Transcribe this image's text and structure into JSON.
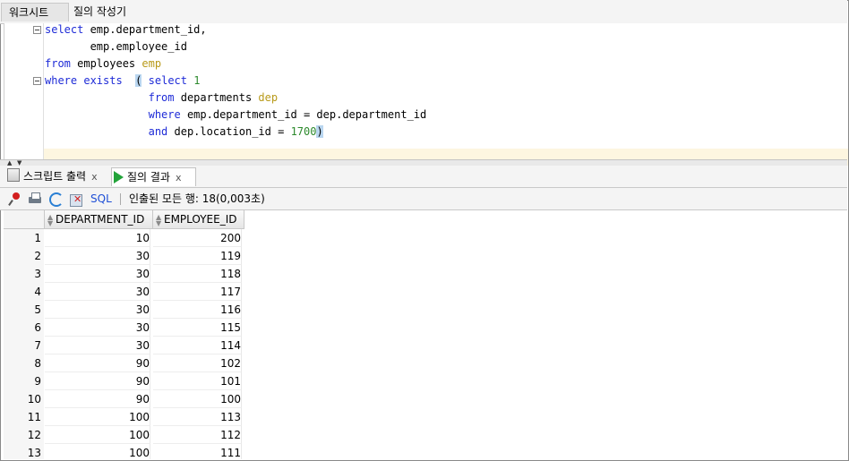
{
  "top_tabs": {
    "worksheet": "워크시트",
    "query_builder": "질의 작성기"
  },
  "editor": {
    "lines": [
      [
        {
          "t": "select",
          "c": "kw"
        },
        {
          "t": " emp.department_id,",
          "c": ""
        }
      ],
      [
        {
          "t": "       emp.employee_id",
          "c": ""
        }
      ],
      [
        {
          "t": "from",
          "c": "kw"
        },
        {
          "t": " employees ",
          "c": ""
        },
        {
          "t": "emp",
          "c": "alias"
        }
      ],
      [
        {
          "t": "where",
          "c": "kw"
        },
        {
          "t": " ",
          "c": ""
        },
        {
          "t": "exists",
          "c": "kw"
        },
        {
          "t": "  ",
          "c": ""
        },
        {
          "t": "(",
          "c": "lpar"
        },
        {
          "t": " ",
          "c": ""
        },
        {
          "t": "select",
          "c": "kw"
        },
        {
          "t": " ",
          "c": ""
        },
        {
          "t": "1",
          "c": "num"
        }
      ],
      [
        {
          "t": "                ",
          "c": ""
        },
        {
          "t": "from",
          "c": "kw"
        },
        {
          "t": " departments ",
          "c": ""
        },
        {
          "t": "dep",
          "c": "alias"
        }
      ],
      [
        {
          "t": "                ",
          "c": ""
        },
        {
          "t": "where",
          "c": "kw"
        },
        {
          "t": " emp.department_id = dep.department_id",
          "c": ""
        }
      ],
      [
        {
          "t": "                ",
          "c": ""
        },
        {
          "t": "and",
          "c": "kw"
        },
        {
          "t": " dep.location_id = ",
          "c": ""
        },
        {
          "t": "1700",
          "c": "num"
        },
        {
          "t": ")",
          "c": "lpar"
        }
      ]
    ]
  },
  "bottom_tabs": {
    "script_output": "스크립트 출력",
    "query_result": "질의 결과",
    "close": "x"
  },
  "toolbar": {
    "sql_label": "SQL",
    "separator": "|",
    "status": "인출된 모든 행: 18(0,003초)"
  },
  "grid": {
    "columns": [
      "DEPARTMENT_ID",
      "EMPLOYEE_ID"
    ],
    "rows": [
      {
        "n": "1",
        "dept": "10",
        "emp": "200"
      },
      {
        "n": "2",
        "dept": "30",
        "emp": "119"
      },
      {
        "n": "3",
        "dept": "30",
        "emp": "118"
      },
      {
        "n": "4",
        "dept": "30",
        "emp": "117"
      },
      {
        "n": "5",
        "dept": "30",
        "emp": "116"
      },
      {
        "n": "6",
        "dept": "30",
        "emp": "115"
      },
      {
        "n": "7",
        "dept": "30",
        "emp": "114"
      },
      {
        "n": "8",
        "dept": "90",
        "emp": "102"
      },
      {
        "n": "9",
        "dept": "90",
        "emp": "101"
      },
      {
        "n": "10",
        "dept": "90",
        "emp": "100"
      },
      {
        "n": "11",
        "dept": "100",
        "emp": "113"
      },
      {
        "n": "12",
        "dept": "100",
        "emp": "112"
      },
      {
        "n": "13",
        "dept": "100",
        "emp": "111"
      }
    ]
  }
}
